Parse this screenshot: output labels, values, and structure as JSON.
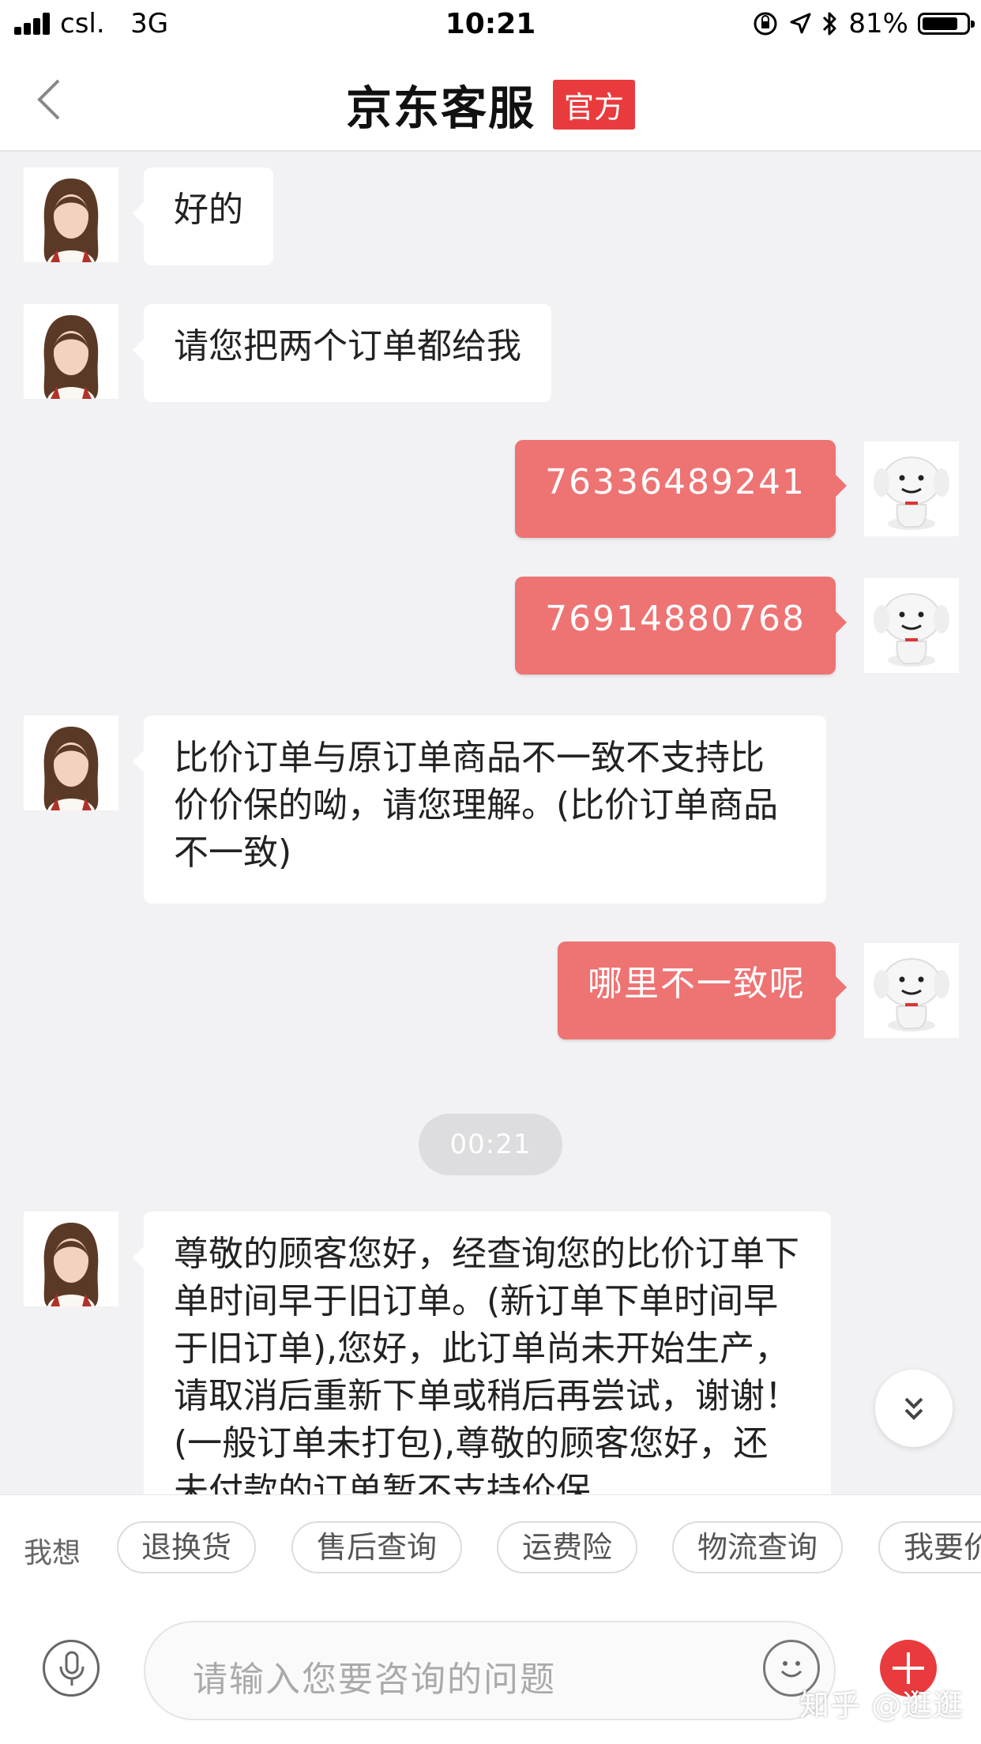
{
  "status_bar": {
    "carrier": "csl.",
    "network": "3G",
    "time": "10:21",
    "battery": "81%",
    "battery_level": 0.81
  },
  "header": {
    "title": "京东客服",
    "badge": "官方"
  },
  "messages": [
    {
      "from": "agent",
      "text": "好的"
    },
    {
      "from": "agent",
      "text": "请您把两个订单都给我"
    },
    {
      "from": "user",
      "text": "76336489241"
    },
    {
      "from": "user",
      "text": "76914880768"
    },
    {
      "from": "agent",
      "text": "比价订单与原订单商品不一致不支持比价价保的呦，请您理解。(比价订单商品不一致)"
    },
    {
      "from": "user",
      "text": "哪里不一致呢"
    },
    {
      "from": "timestamp",
      "text": "00:21"
    },
    {
      "from": "agent",
      "text": " 尊敬的顾客您好，经查询您的比价订单下单时间早于旧订单。(新订单下单时间早于旧订单),您好，此订单尚未开始生产，请取消后重新下单或稍后再尝试，谢谢！(一般订单未打包),尊敬的顾客您好，还未付款的订单暂不支持价保"
    }
  ],
  "quick_bar": {
    "prefix": "我想",
    "chips": [
      "退换货",
      "售后查询",
      "运费险",
      "物流查询",
      "我要价保"
    ]
  },
  "input": {
    "placeholder": "请输入您要咨询的问题"
  },
  "watermark": "知乎 @逛逛",
  "colors": {
    "brand_red": "#e93b3d",
    "user_bubble": "#ee7373",
    "background": "#f2f2f4"
  },
  "icons": [
    "back-chevron-icon",
    "location-arrow-icon",
    "bluetooth-icon",
    "microphone-icon",
    "emoji-icon",
    "plus-icon",
    "double-chevron-down-icon"
  ]
}
